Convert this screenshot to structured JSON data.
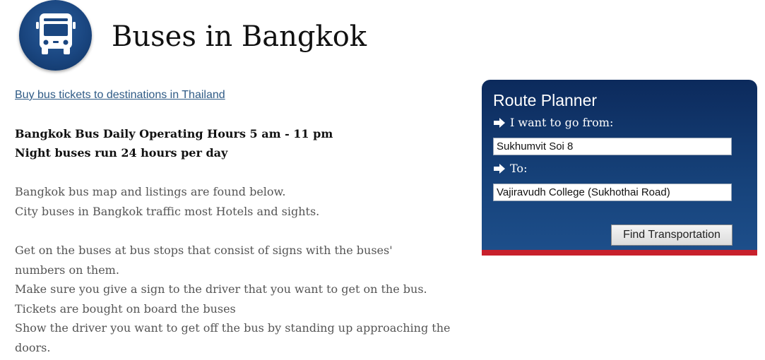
{
  "header": {
    "logo_icon": "bus-icon",
    "title": "Buses in Bangkok"
  },
  "content": {
    "ticket_link": "Buy bus tickets to destinations in Thailand",
    "hours": [
      "Bangkok Bus Daily Operating Hours 5 am - 11 pm",
      "Night buses run 24 hours per day"
    ],
    "intro": [
      "Bangkok bus map and listings are found below.",
      "City buses in Bangkok traffic most Hotels and sights."
    ],
    "tips": [
      "Get on the buses at bus stops that consist of signs with the buses'",
      "numbers on them.",
      "Make sure you give a sign to the driver that you want to get on the bus.",
      "Tickets are bought on board the buses",
      "Show the driver you want to get off the bus by standing up approaching the",
      "doors."
    ]
  },
  "route_planner": {
    "title": "Route Planner",
    "from_label": "I want to go from:",
    "from_value": "Sukhumvit Soi 8",
    "to_label": "To:",
    "to_value": "Vajiravudh College (Sukhothai Road)",
    "submit_label": "Find Transportation",
    "arrow_icon": "arrow-right-icon"
  },
  "colors": {
    "link": "#2f5b86",
    "planner_top": "#0c2a5c",
    "planner_bottom": "#1d4e8a",
    "planner_accent": "#c8202c",
    "logo": "#1a4680"
  }
}
